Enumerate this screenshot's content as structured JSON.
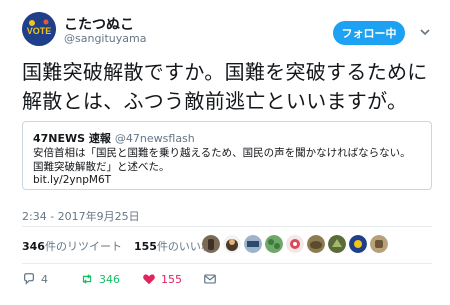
{
  "header": {
    "display_name": "こたつぬこ",
    "handle": "@sangituyama",
    "avatar_text": "VOTE",
    "follow_button_label": "フォロー中"
  },
  "tweet": {
    "text_line1": "国難突破解散ですか。国難を突破するために",
    "text_line2": "解散とは、ふつう敵前逃亡といいますが。",
    "timestamp": "2:34 - 2017年9月25日"
  },
  "quote": {
    "name": "47NEWS 速報",
    "handle": "@47newsflash",
    "body": "安倍首相は「国民と国難を乗り越えるため、国民の声を聞かなければならない。国難突破解散だ」と述べた。",
    "link": "bit.ly/2ynpM6T"
  },
  "stats": {
    "retweets_count": "346",
    "retweets_label": "件のリツイート",
    "likes_count": "155",
    "likes_label": "件のいいね"
  },
  "actions": {
    "reply_count": "4",
    "retweet_count": "346",
    "like_count": "155"
  },
  "colors": {
    "brand": "#1da1f2",
    "retweet": "#17bf63",
    "like": "#e0245e",
    "muted": "#657786"
  }
}
